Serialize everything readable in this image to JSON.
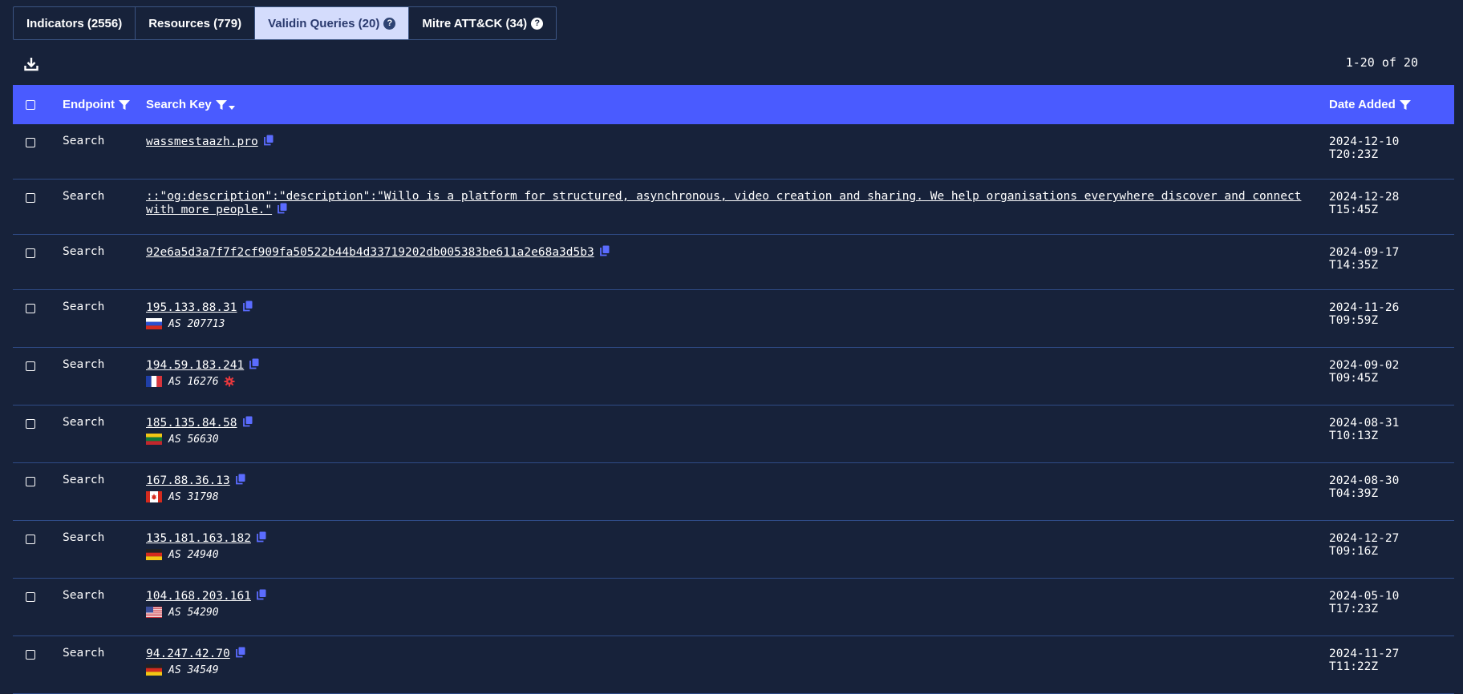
{
  "tabs": [
    {
      "label": "Indicators (2556)",
      "active": false,
      "help": false
    },
    {
      "label": "Resources (779)",
      "active": false,
      "help": false
    },
    {
      "label": "Validin Queries (20)",
      "active": true,
      "help": true
    },
    {
      "label": "Mitre ATT&CK (34)",
      "active": false,
      "help": true
    }
  ],
  "help_glyph": "?",
  "toolbar": {
    "download_icon": "download-icon",
    "pagination": "1-20 of 20"
  },
  "table": {
    "headers": {
      "endpoint": "Endpoint",
      "search_key": "Search Key",
      "date_added": "Date Added"
    },
    "rows": [
      {
        "endpoint": "Search",
        "key": "wassmestaazh.pro",
        "date": "2024-12-10T20:23Z"
      },
      {
        "endpoint": "Search",
        "key": "::\"og:description\":\"description\":\"Willo is a platform for structured, asynchronous, video creation and sharing. We help organisations everywhere discover and connect with more people.\"",
        "date": "2024-12-28T15:45Z"
      },
      {
        "endpoint": "Search",
        "key": "92e6a5d3a7f7f2cf909fa50522b44b4d33719202db005383be611a2e68a3d5b3",
        "date": "2024-09-17T14:35Z"
      },
      {
        "endpoint": "Search",
        "key": "195.133.88.31",
        "flag": "ru",
        "asn": "AS 207713",
        "date": "2024-11-26T09:59Z"
      },
      {
        "endpoint": "Search",
        "key": "194.59.183.241",
        "flag": "fr",
        "asn": "AS 16276",
        "badge": "red-gear-icon",
        "date": "2024-09-02T09:45Z"
      },
      {
        "endpoint": "Search",
        "key": "185.135.84.58",
        "flag": "lt",
        "asn": "AS 56630",
        "date": "2024-08-31T10:13Z"
      },
      {
        "endpoint": "Search",
        "key": "167.88.36.13",
        "flag": "ca",
        "asn": "AS 31798",
        "date": "2024-08-30T04:39Z"
      },
      {
        "endpoint": "Search",
        "key": "135.181.163.182",
        "flag": "de",
        "asn": "AS 24940",
        "date": "2024-12-27T09:16Z"
      },
      {
        "endpoint": "Search",
        "key": "104.168.203.161",
        "flag": "us",
        "asn": "AS 54290",
        "date": "2024-05-10T17:23Z"
      },
      {
        "endpoint": "Search",
        "key": "94.247.42.70",
        "flag": "de",
        "asn": "AS 34549",
        "date": "2024-11-27T11:22Z"
      }
    ]
  },
  "colors": {
    "background": "#17223a",
    "header": "#4a5bff",
    "active_tab": "#d4dcfc",
    "copy_icon": "#5b6cff",
    "row_border": "#2f4b86"
  }
}
